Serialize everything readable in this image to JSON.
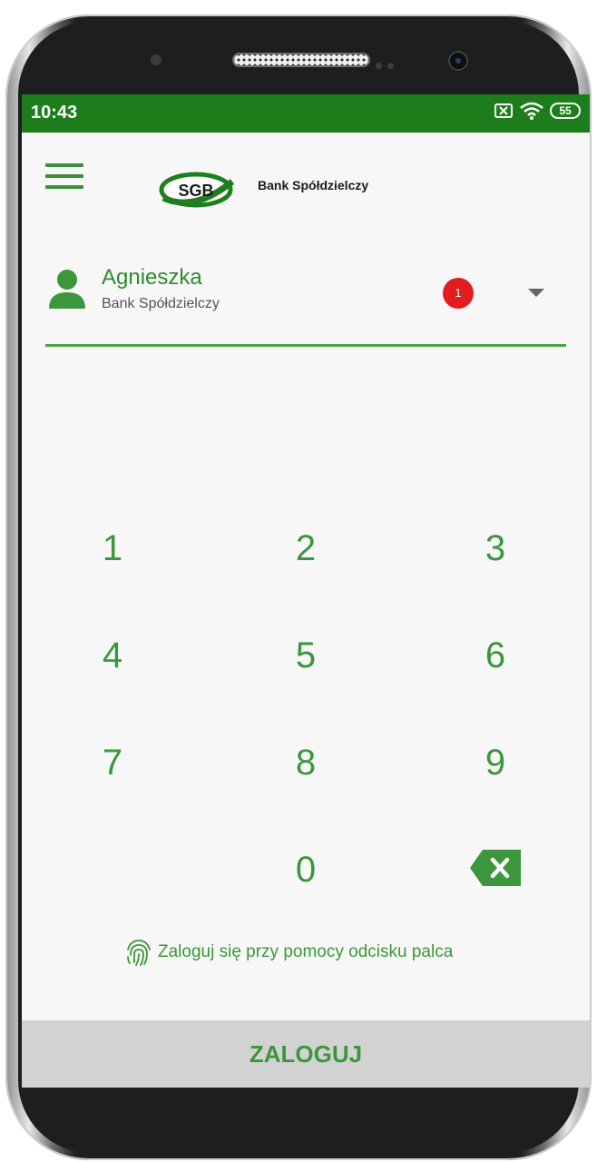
{
  "status": {
    "time": "10:43",
    "battery": "55"
  },
  "header": {
    "logo_text": "SGB",
    "bank_name": "Bank Spółdzielczy"
  },
  "account": {
    "name": "Agnieszka",
    "bank": "Bank Spółdzielczy",
    "notifications": "1"
  },
  "keypad": {
    "k1": "1",
    "k2": "2",
    "k3": "3",
    "k4": "4",
    "k5": "5",
    "k6": "6",
    "k7": "7",
    "k8": "8",
    "k9": "9",
    "k0": "0"
  },
  "fingerprint_label": "Zaloguj się przy pomocy odcisku palca",
  "login_label": "ZALOGUJ",
  "colors": {
    "statusbar": "#1e7d1b",
    "accent": "#3c963c",
    "badge": "#e31d1d",
    "login_bar": "#d2d2d2"
  }
}
